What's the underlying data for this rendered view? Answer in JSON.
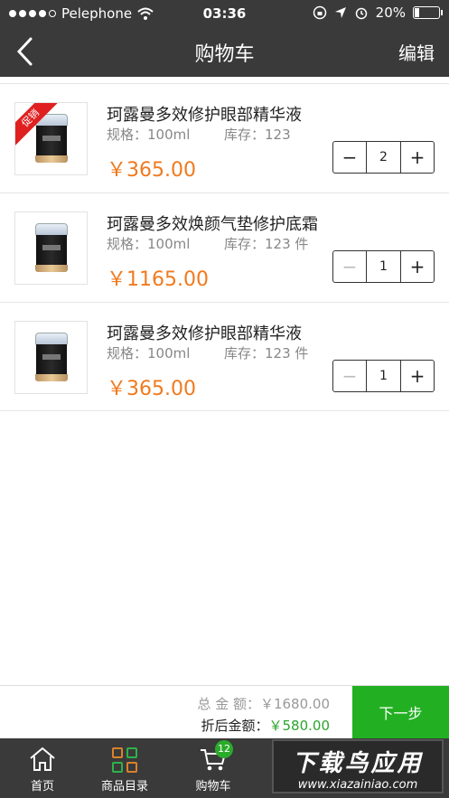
{
  "status_bar": {
    "carrier": "Pelephone",
    "time": "03:36",
    "battery": "20%"
  },
  "nav": {
    "title": "购物车",
    "edit_label": "编辑"
  },
  "cart_items": [
    {
      "name": "珂露曼多效修护眼部精华液",
      "spec": "规格：100ml",
      "stock": "库存：123",
      "price": "￥365.00",
      "qty": "2",
      "promo": "促销",
      "minus_enabled": true
    },
    {
      "name": "珂露曼多效焕颜气垫修护底霜",
      "spec": "规格：100ml",
      "stock": "库存：123 件",
      "price": "￥1165.00",
      "qty": "1",
      "promo": "",
      "minus_enabled": false
    },
    {
      "name": "珂露曼多效修护眼部精华液",
      "spec": "规格：100ml",
      "stock": "库存：123 件",
      "price": "￥365.00",
      "qty": "1",
      "promo": "",
      "minus_enabled": false
    }
  ],
  "stepper": {
    "minus": "−",
    "plus": "+"
  },
  "summary": {
    "total_label": "总 金 额：",
    "total_value": "￥1680.00",
    "discount_label": "折后金额：",
    "discount_value": "￥580.00",
    "next_label": "下一步"
  },
  "tabs": [
    {
      "label": "首页",
      "icon": "home-icon"
    },
    {
      "label": "商品目录",
      "icon": "catalog-icon"
    },
    {
      "label": "购物车",
      "icon": "cart-icon",
      "badge": "12"
    }
  ],
  "watermark": {
    "text": "下载鸟应用",
    "url": "www.xiazainiao.com"
  }
}
